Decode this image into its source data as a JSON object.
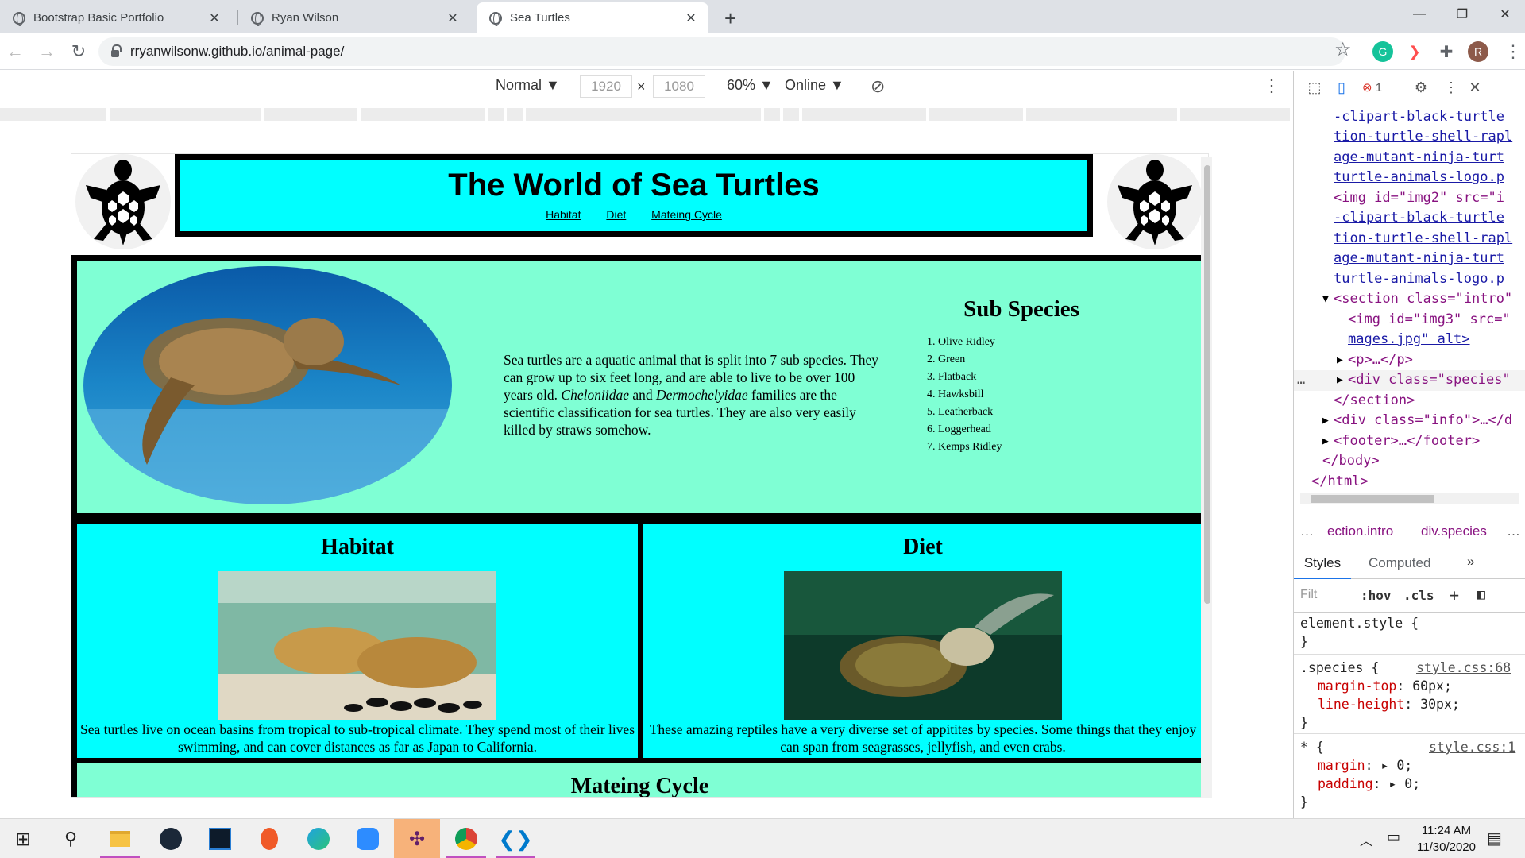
{
  "browser": {
    "tabs": [
      {
        "title": "Bootstrap Basic Portfolio"
      },
      {
        "title": "Ryan Wilson"
      },
      {
        "title": "Sea Turtles"
      }
    ],
    "url": "rryanwilsonw.github.io/animal-page/",
    "profile_initial": "R"
  },
  "device_toolbar": {
    "mode": "Normal",
    "width": "1920",
    "height": "1080",
    "zoom": "60%",
    "throttle": "Online"
  },
  "page": {
    "title": "The World of Sea Turtles",
    "nav": [
      "Habitat",
      "Diet",
      "Mateing Cycle"
    ],
    "intro_text_1": "Sea turtles are a aquatic animal that is split into 7 sub species. They can grow up to six feet long, and are able to live to be over 100 years old. ",
    "intro_em_1": "Cheloniidae",
    "intro_and": " and ",
    "intro_em_2": "Dermochelyidae",
    "intro_text_2": " families are the scientific classification for sea turtles. They are also very easily killed by straws somehow.",
    "species_title": "Sub Species",
    "species": [
      "Olive Ridley",
      "Green",
      "Flatback",
      "Hawksbill",
      "Leatherback",
      "Loggerhead",
      "Kemps Ridley"
    ],
    "habitat_title": "Habitat",
    "habitat_text": "Sea turtles live on ocean basins from tropical to sub-tropical climate. They spend most of their lives swimming, and can cover distances as far as Japan to California.",
    "diet_title": "Diet",
    "diet_text": "These amazing reptiles have a very diverse set of appitites by species. Some things that they enjoy can span from seagrasses, jellyfish, and even crabs.",
    "mating_title": "Mateing Cycle"
  },
  "devtools": {
    "error_count": "1",
    "dom_lines": [
      {
        "text": "-clipart-black-turtle"
      },
      {
        "text": "tion-turtle-shell-rapl"
      },
      {
        "text": "age-mutant-ninja-turt"
      },
      {
        "text": "turtle-animals-logo.p"
      },
      {
        "text": "-clipart-black-turtle"
      },
      {
        "text": "tion-turtle-shell-rapl"
      },
      {
        "text": "age-mutant-ninja-turt"
      },
      {
        "text": "turtle-animals-logo.p"
      }
    ],
    "img2_tag": "<img id=\"img2\" src=\"i",
    "section_tag": "<section class=\"intro\"",
    "img3_tag": "<img id=\"img3\" src=\"",
    "img3_cont": "mages.jpg\" alt>",
    "p_tag": "<p>…</p>",
    "div_species_tag": "<div class=\"species\"",
    "section_close": "</section>",
    "div_info_tag": "<div class=\"info\">…</d",
    "footer_tag": "<footer>…</footer>",
    "body_close": "</body>",
    "html_close": "</html>",
    "crumbs": [
      "ection.intro",
      "div.species"
    ],
    "subtabs": [
      "Styles",
      "Computed"
    ],
    "filter_placeholder": "Filt",
    "hov": ":hov",
    "cls": ".cls",
    "element_style": "element.style {",
    "close_brace": "}",
    "rule1_selector": ".species {",
    "rule1_source": "style.css:68",
    "rule1_props": [
      {
        "name": "margin-top",
        "value": "60px;"
      },
      {
        "name": "line-height",
        "value": "30px;"
      }
    ],
    "rule2_selector": "* {",
    "rule2_source": "style.css:1",
    "rule2_props": [
      {
        "name": "margin",
        "value": "0;"
      },
      {
        "name": "padding",
        "value": "0;"
      }
    ]
  },
  "taskbar": {
    "time": "11:24 AM",
    "date": "11/30/2020"
  },
  "colors": {
    "aqua": "#00ffff",
    "aquamarine": "#7fffd4"
  }
}
